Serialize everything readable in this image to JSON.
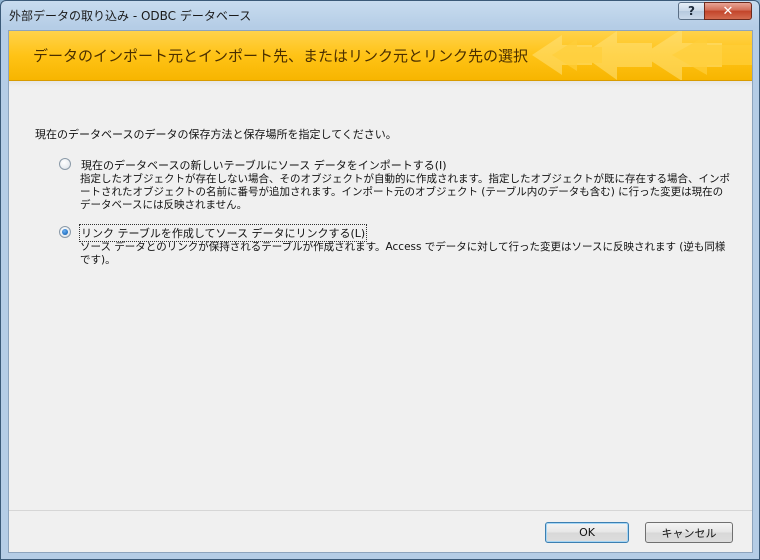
{
  "window": {
    "title": "外部データの取り込み - ODBC データベース",
    "help_glyph": "?",
    "close_glyph": "✕"
  },
  "banner": {
    "title": "データのインポート元とインポート先、またはリンク元とリンク先の選択",
    "color_top": "#ffd24a",
    "color_bottom": "#f7b500"
  },
  "instruction": "現在のデータベースのデータの保存方法と保存場所を指定してください。",
  "options": [
    {
      "label": "現在のデータベースの新しいテーブルにソース データをインポートする(I)",
      "description": "指定したオブジェクトが存在しない場合、そのオブジェクトが自動的に作成されます。指定したオブジェクトが既に存在する場合、インポートされたオブジェクトの名前に番号が追加されます。インポート元のオブジェクト (テーブル内のデータも含む) に行った変更は現在のデータベースには反映されません。",
      "checked": false
    },
    {
      "label": "リンク テーブルを作成してソース データにリンクする(L)",
      "description": "ソース データとのリンクが保持されるテーブルが作成されます。Access でデータに対して行った変更はソースに反映されます (逆も同様です)。",
      "checked": true
    }
  ],
  "buttons": {
    "ok": "OK",
    "cancel": "キャンセル"
  }
}
